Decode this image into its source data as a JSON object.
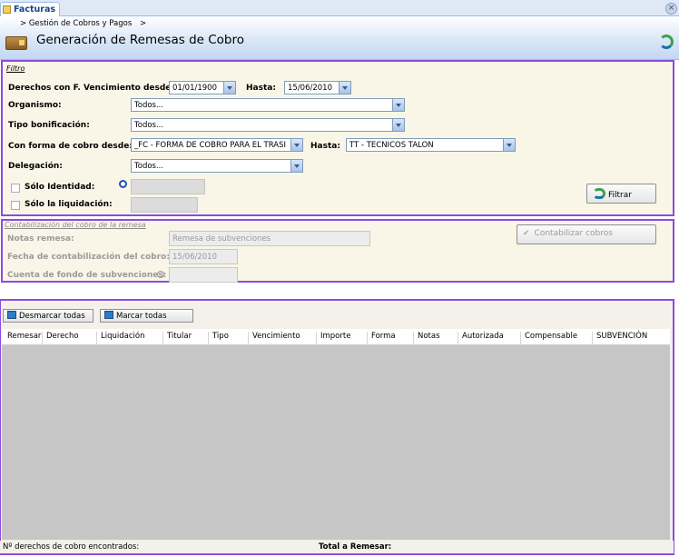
{
  "tab": {
    "title": "Facturas",
    "close": "×"
  },
  "breadcrumb": {
    "root": "> Gestión de Cobros y Pagos",
    "sep": ">"
  },
  "page_title": "Generación de Remesas de Cobro",
  "filter": {
    "legend": "Filtro",
    "derechos_label": "Derechos con F. Vencimiento desde:",
    "fecha_desde": "01/01/1900",
    "hasta_label": "Hasta:",
    "fecha_hasta": "15/06/2010",
    "organismo_label": "Organismo:",
    "organismo_value": "Todos...",
    "tipo_bonif_label": "Tipo bonificación:",
    "tipo_bonif_value": "Todos...",
    "forma_cobro_label": "Con forma de cobro desde:",
    "forma_cobro_desde": "_FC - FORMA DE COBRO PARA EL TRASI",
    "forma_hasta_label": "Hasta:",
    "forma_cobro_hasta": "TT - TECNICOS TALON",
    "delegacion_label": "Delegación:",
    "delegacion_value": "Todos...",
    "solo_identidad_label": "Sólo Identidad:",
    "solo_liquidacion_label": "Sólo  la liquidación:",
    "filtrar_label": "Filtrar"
  },
  "contab": {
    "legend": "Contabilización del cobro de la remesa",
    "notas_label": "Notas remesa:",
    "notas_value": "Remesa de subvenciones",
    "fecha_label": "Fecha de contabilización del cobro:",
    "fecha_value": "15/06/2010",
    "cuenta_label": "Cuenta de fondo de subvenciones:",
    "contabilizar_label": "Contabilizar cobros"
  },
  "grid": {
    "desmarcar_label": "Desmarcar todas",
    "marcar_label": "Marcar todas",
    "columns": [
      "Remesar",
      "Derecho",
      "Liquidación",
      "Titular",
      "Tipo",
      "Vencimiento",
      "Importe",
      "Forma",
      "Notas",
      "Autorizada",
      "Compensable",
      "SUBVENCIÓN"
    ],
    "found_label": "Nº derechos de cobro encontrados:",
    "total_label": "Total a Remesar:"
  },
  "colors": {
    "accent_outline": "#8c4be0",
    "header_blue": "#c2d7f1",
    "panel_bg": "#f9f6e7",
    "grid_bg": "#c6c6c6"
  }
}
